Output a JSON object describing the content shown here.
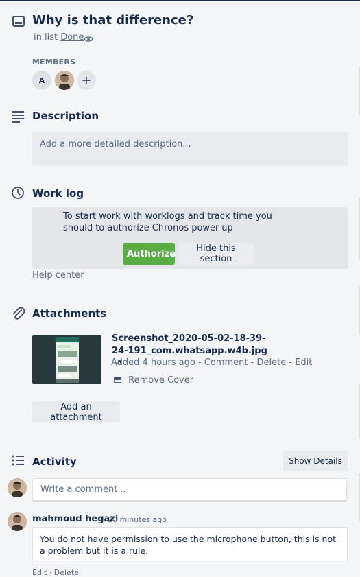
{
  "card": {
    "title": "Why is that difference?",
    "in_list_prefix": "in list",
    "list_name": "Done"
  },
  "members": {
    "label": "MEMBERS",
    "initial": "A",
    "add_symbol": "+"
  },
  "description": {
    "heading": "Description",
    "placeholder": "Add a more detailed description..."
  },
  "worklog": {
    "heading": "Work log",
    "message": "To start work with worklogs and track time you should to authorize Chronos power-up",
    "authorize_label": "Authorize",
    "hide_label": "Hide this section",
    "help_label": "Help center"
  },
  "attachments": {
    "heading": "Attachments",
    "file_name": "Screenshot_2020-05-02-18-39-24-191_com.whatsapp.w4b.jpg",
    "open_symbol": "↗",
    "added": "Added 4 hours ago",
    "comment_label": "Comment",
    "delete_label": "Delete",
    "edit_label": "Edit",
    "separator": "-",
    "remove_cover_label": "Remove Cover",
    "add_label": "Add an attachment"
  },
  "activity": {
    "heading": "Activity",
    "show_details_label": "Show Details",
    "comment_placeholder": "Write a comment...",
    "author": "mahmoud hegazi",
    "time": "20 minutes ago",
    "comment_text": "You do not have permission to use the microphone button, this is not a problem but it is a rule.",
    "bottom_hint": "Edit · Delete"
  },
  "colors": {
    "accent_green": "#5aac44",
    "background": "#f4f5f7",
    "text": "#172b4d",
    "muted": "#5e6c84"
  },
  "icons": [
    "card-icon",
    "eye-icon",
    "description-icon",
    "clock-icon",
    "paperclip-icon",
    "card-cover-icon",
    "activity-icon",
    "open-external-icon"
  ]
}
